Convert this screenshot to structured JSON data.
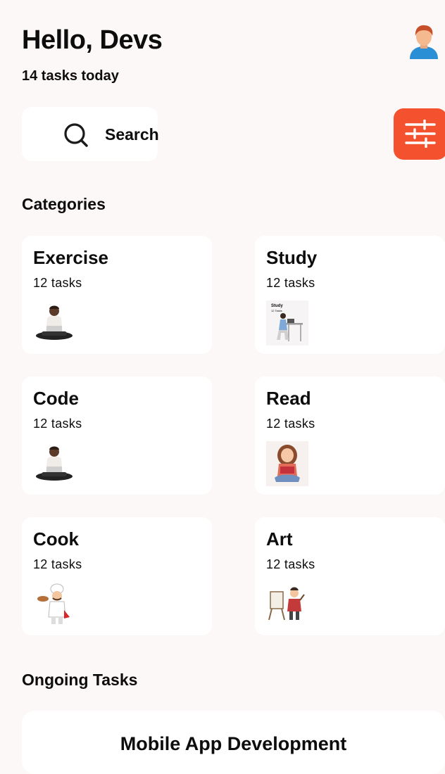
{
  "header": {
    "greeting": "Hello, Devs",
    "subtitle": "14 tasks today",
    "avatar_icon": "user-avatar-icon"
  },
  "search": {
    "label": "Search",
    "icon": "search-icon"
  },
  "filter": {
    "icon": "sliders-icon",
    "color": "#f4522e"
  },
  "categories": {
    "title": "Categories",
    "items": [
      {
        "name": "Exercise",
        "count": "12 tasks",
        "illustration": "person-with-laptop-illustration"
      },
      {
        "name": "Study",
        "count": "12 tasks",
        "illustration": "person-at-desk-illustration"
      },
      {
        "name": "Code",
        "count": "12 tasks",
        "illustration": "person-with-laptop-illustration"
      },
      {
        "name": "Read",
        "count": "12 tasks",
        "illustration": "girl-reading-illustration"
      },
      {
        "name": "Cook",
        "count": "12 tasks",
        "illustration": "chef-illustration"
      },
      {
        "name": "Art",
        "count": "12 tasks",
        "illustration": "painter-easel-illustration"
      }
    ],
    "study_thumb_text": {
      "title": "Study",
      "sub": "12 Tasks"
    }
  },
  "ongoing": {
    "title": "Ongoing Tasks",
    "tasks": [
      {
        "title": "Mobile App Development"
      }
    ]
  },
  "colors": {
    "background": "#fcf8f7",
    "card": "#ffffff",
    "accent": "#f4522e",
    "text": "#0d0d0d"
  }
}
